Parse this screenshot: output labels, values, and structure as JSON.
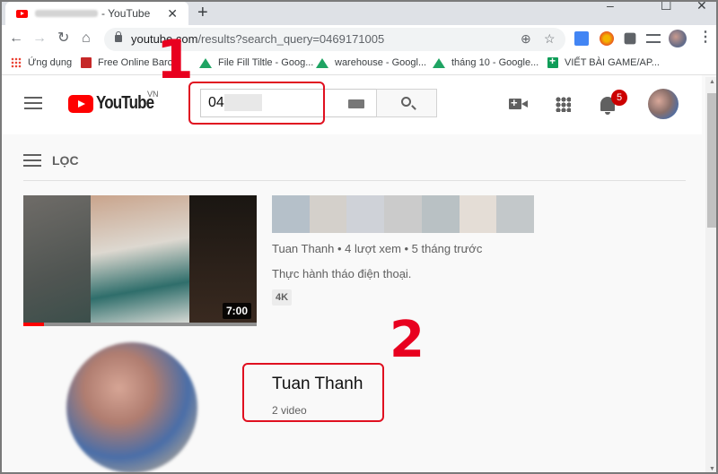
{
  "browser": {
    "tab": {
      "title_suffix": "- YouTube",
      "close": "✕"
    },
    "new_tab": "+",
    "window_controls": {
      "minimize": "–",
      "maximize": "☐",
      "close": "✕"
    },
    "nav": {
      "back": "←",
      "forward": "→",
      "reload": "↻",
      "home": "⌂"
    },
    "url": {
      "domain": "youtube.com",
      "path": "/results?search_query=0469171005"
    },
    "omnibox_icons": {
      "zoom": "⊕",
      "star": "☆"
    },
    "menu": "⋮",
    "bookmarks": [
      {
        "label": "Ứng dụng",
        "icon": "apps-icon"
      },
      {
        "label": "Free Online Barco",
        "icon": "barcode-icon"
      },
      {
        "label": "File Fill Tiltle - Goog...",
        "icon": "google-drive-icon"
      },
      {
        "label": "warehouse - Googl...",
        "icon": "google-drive-icon"
      },
      {
        "label": "tháng 10 - Google...",
        "icon": "google-drive-icon"
      },
      {
        "label": "VIẾT BÀI GAME/AP...",
        "icon": "google-sheets-icon"
      }
    ]
  },
  "youtube": {
    "logo": {
      "text": "YouTube",
      "region": "VN"
    },
    "search": {
      "value": "04"
    },
    "notifications_count": "5",
    "filter_label": "LỌC",
    "video": {
      "duration": "7:00",
      "progress_fraction": 0.09,
      "meta": "Tuan Thanh • 4 lượt xem • 5 tháng trước",
      "description": "Thực hành tháo điện thoại.",
      "badge": "4K"
    },
    "channel": {
      "name": "Tuan Thanh",
      "video_count": "2 video"
    }
  },
  "annotations": {
    "step1": "1",
    "step2": "2",
    "color": "#e8001f"
  },
  "colors": {
    "youtube_red": "#ff0000",
    "badge_red": "#cc0000"
  }
}
